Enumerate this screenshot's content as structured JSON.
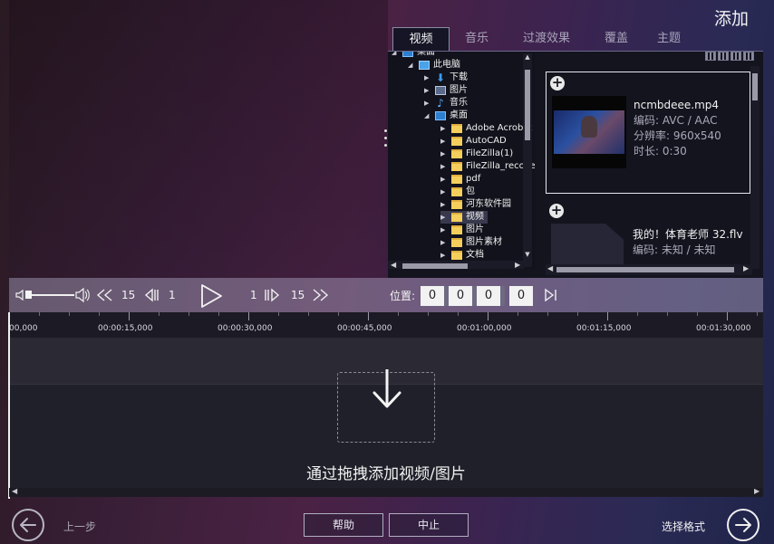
{
  "header": {
    "title": "添加"
  },
  "library": {
    "tabs": [
      {
        "label": "视频",
        "active": true
      },
      {
        "label": "音乐",
        "active": false
      },
      {
        "label": "过渡效果",
        "active": false
      },
      {
        "label": "覆盖",
        "active": false
      },
      {
        "label": "主题",
        "active": false
      }
    ],
    "tree": [
      {
        "label": "桌面",
        "icon": "desktop-icon",
        "expanded": true,
        "level": 0
      },
      {
        "label": "此电脑",
        "icon": "computer-icon",
        "expanded": true,
        "level": 1
      },
      {
        "label": "下载",
        "icon": "download-icon",
        "expanded": false,
        "level": 2
      },
      {
        "label": "图片",
        "icon": "pictures-icon",
        "expanded": false,
        "level": 2
      },
      {
        "label": "音乐",
        "icon": "music-icon",
        "expanded": false,
        "level": 2
      },
      {
        "label": "桌面",
        "icon": "desktop-icon",
        "expanded": true,
        "level": 2
      },
      {
        "label": "Adobe Acrobat",
        "icon": "folder-icon",
        "expanded": false,
        "level": 3
      },
      {
        "label": "AutoCAD",
        "icon": "folder-icon",
        "expanded": false,
        "level": 3
      },
      {
        "label": "FileZilla(1)",
        "icon": "folder-icon",
        "expanded": false,
        "level": 3
      },
      {
        "label": "FileZilla_recovery",
        "icon": "folder-icon",
        "expanded": false,
        "level": 3
      },
      {
        "label": "pdf",
        "icon": "folder-icon",
        "expanded": false,
        "level": 3
      },
      {
        "label": "包",
        "icon": "folder-icon",
        "expanded": false,
        "level": 3
      },
      {
        "label": "河东软件园",
        "icon": "folder-icon",
        "expanded": false,
        "level": 3
      },
      {
        "label": "视频",
        "icon": "folder-icon",
        "expanded": false,
        "level": 3,
        "selected": true
      },
      {
        "label": "图片",
        "icon": "folder-icon",
        "expanded": false,
        "level": 3
      },
      {
        "label": "图片素材",
        "icon": "folder-icon",
        "expanded": false,
        "level": 3
      },
      {
        "label": "文档",
        "icon": "folder-icon",
        "expanded": false,
        "level": 3
      }
    ],
    "media": [
      {
        "name": "ncmbdeee.mp4",
        "codec": "编码: AVC / AAC",
        "resolution": "分辨率: 960x540",
        "duration": "时长: 0:30",
        "selected": true
      },
      {
        "name": "我的！体育老师 32.flv",
        "codec": "编码: 未知 / 未知",
        "selected": false
      }
    ]
  },
  "transport": {
    "step_big_back": "15",
    "step_small_back": "1",
    "step_small_fwd": "1",
    "step_big_fwd": "15",
    "position_label": "位置:",
    "position": [
      "0",
      "0",
      "0",
      "0"
    ]
  },
  "timeline": {
    "ticks": [
      "00,000",
      "00:00:15,000",
      "00:00:30,000",
      "00:00:45,000",
      "00:01:00,000",
      "00:01:15,000",
      "00:01:30,000"
    ],
    "drop_hint": "通过拖拽添加视频/图片"
  },
  "footer": {
    "back_label": "上一步",
    "help_label": "帮助",
    "stop_label": "中止",
    "next_label": "选择格式"
  }
}
